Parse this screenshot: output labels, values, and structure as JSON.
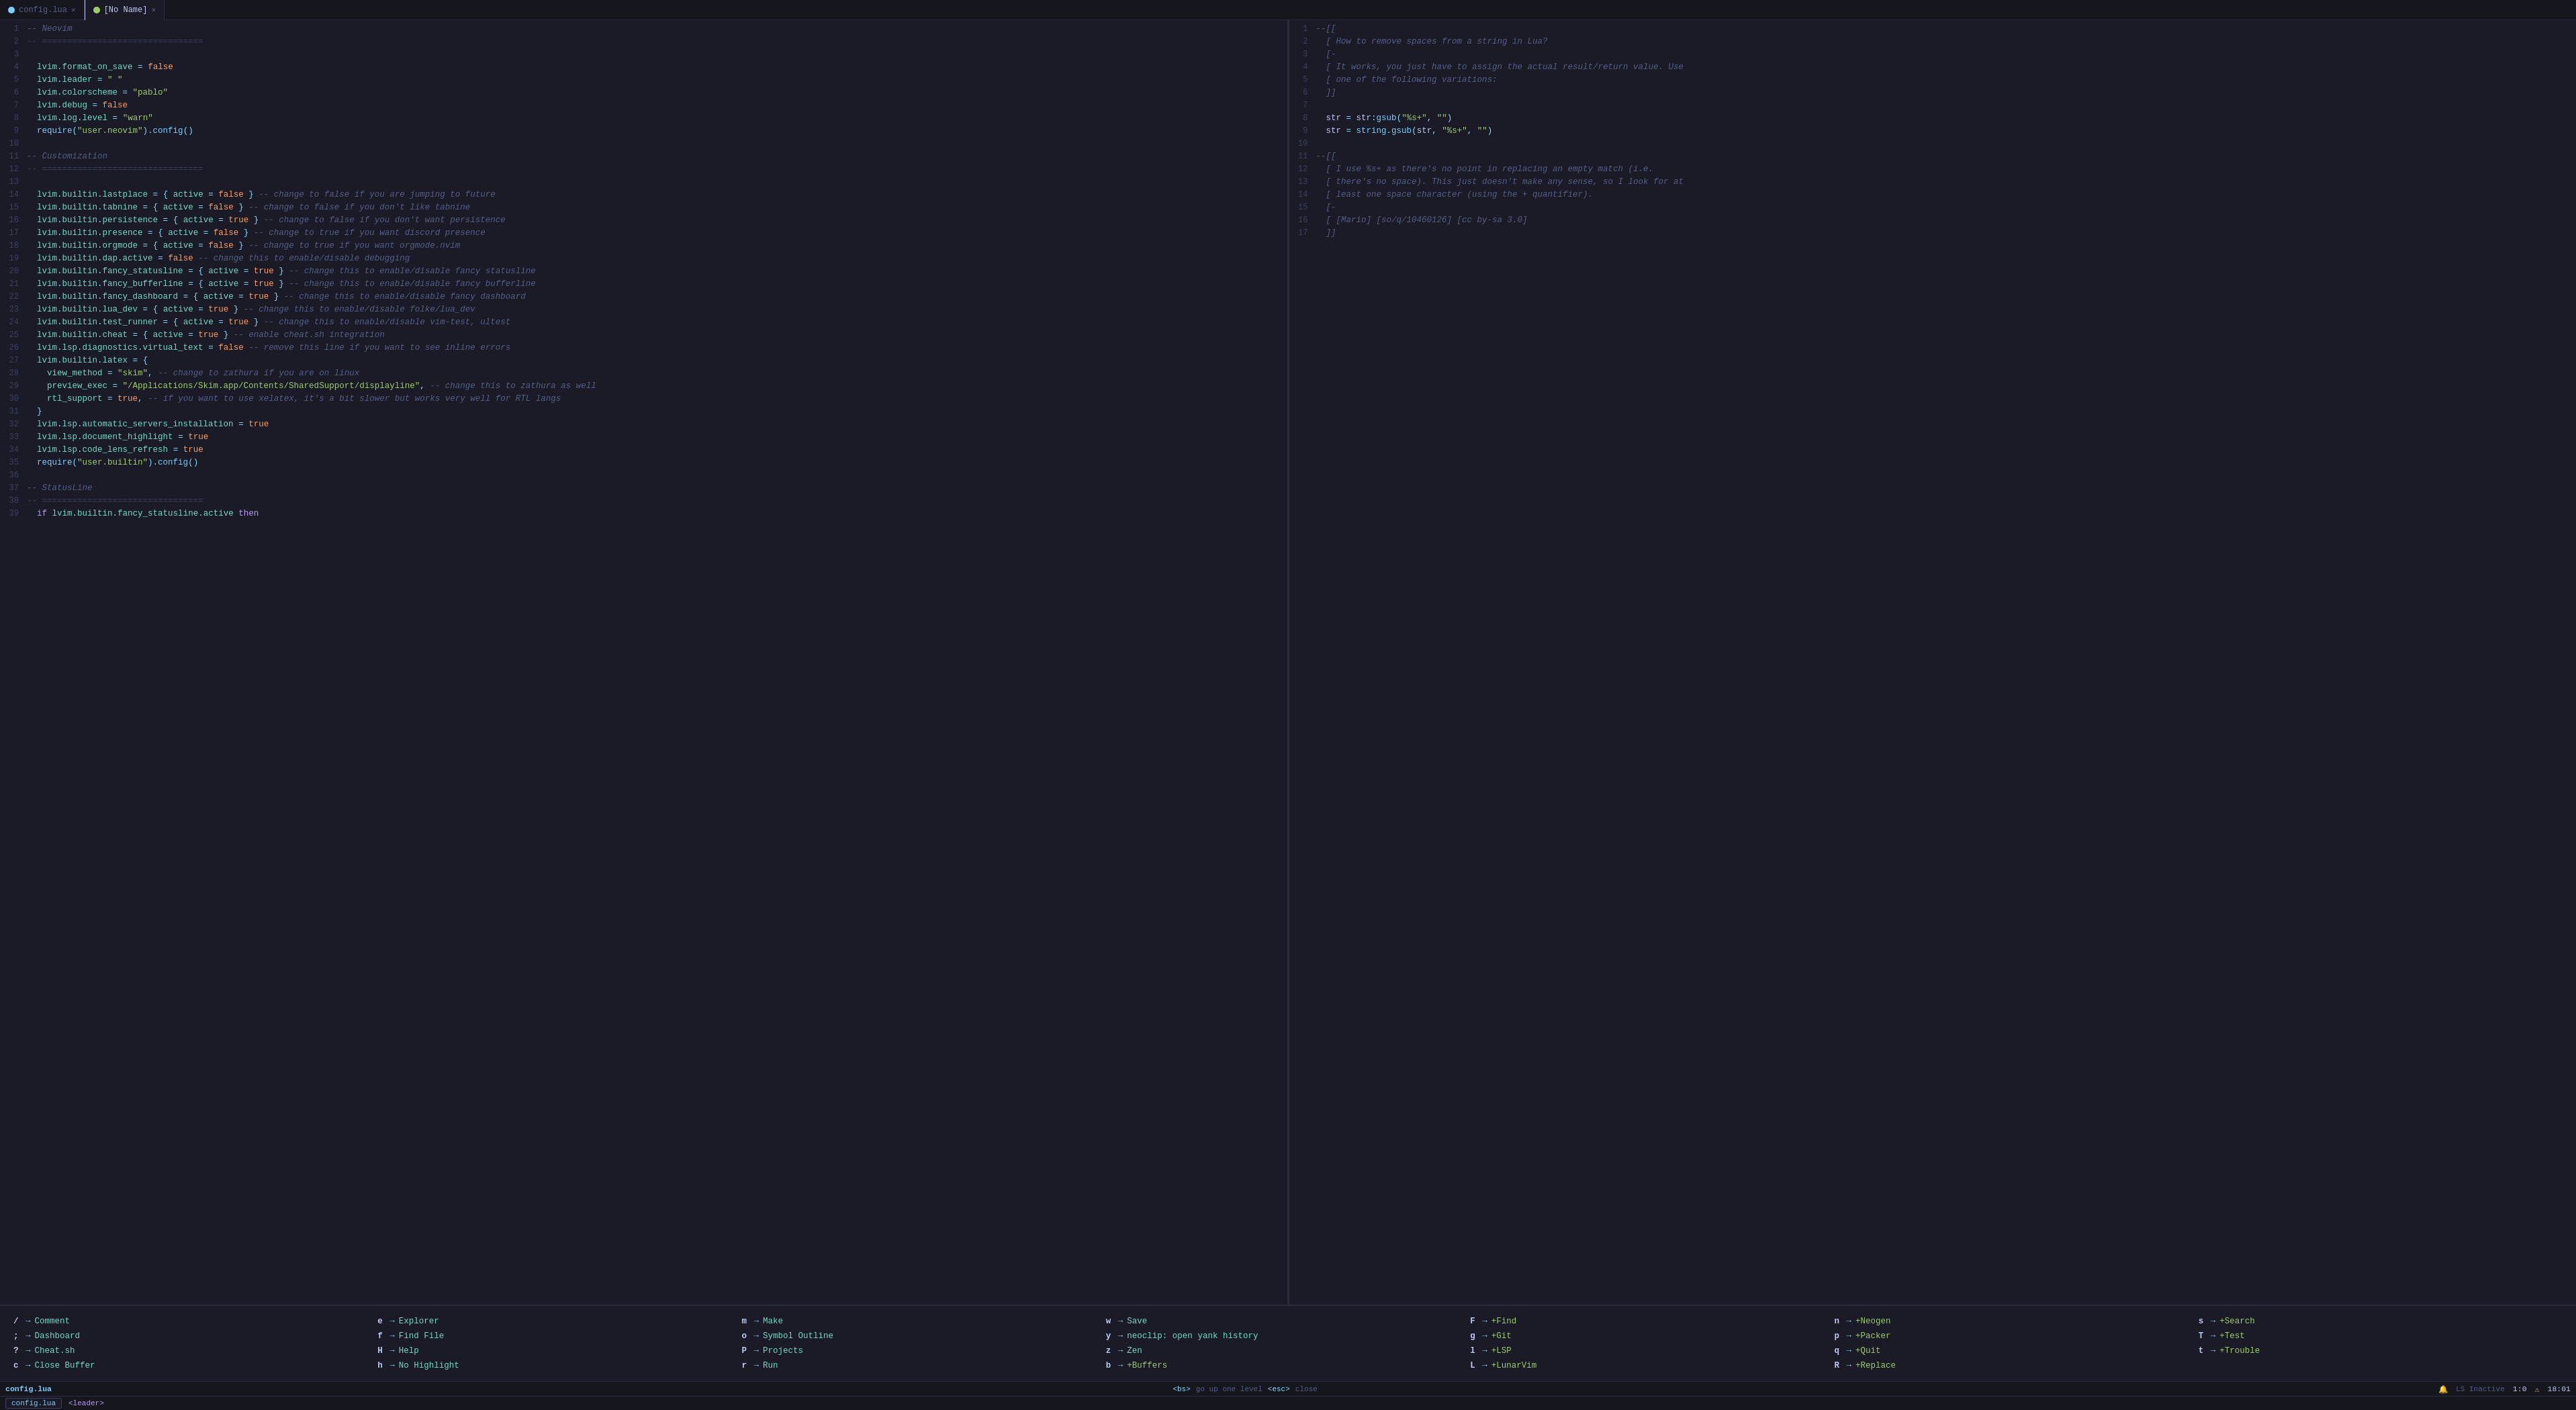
{
  "tabs": [
    {
      "id": "config-lua",
      "label": "config.lua",
      "icon": "lua",
      "active": false,
      "closable": true
    },
    {
      "id": "no-name",
      "label": "[No Name]",
      "icon": "noname",
      "active": true,
      "closable": true
    }
  ],
  "left_editor": {
    "filename": "config.lua",
    "lines": [
      {
        "n": 1,
        "text": "-- Neovim"
      },
      {
        "n": 2,
        "text": "-- ================================"
      },
      {
        "n": 3,
        "text": ""
      },
      {
        "n": 4,
        "text": "  lvim.format_on_save = false"
      },
      {
        "n": 5,
        "text": "  lvim.leader = \" \""
      },
      {
        "n": 6,
        "text": "  lvim.colorscheme = \"pablo\""
      },
      {
        "n": 7,
        "text": "  lvim.debug = false"
      },
      {
        "n": 8,
        "text": "  lvim.log.level = \"warn\""
      },
      {
        "n": 9,
        "text": "  require(\"user.neovim\").config()"
      },
      {
        "n": 10,
        "text": ""
      },
      {
        "n": 11,
        "text": "-- Customization"
      },
      {
        "n": 12,
        "text": "-- ================================"
      },
      {
        "n": 13,
        "text": ""
      },
      {
        "n": 14,
        "text": "  lvim.builtin.lastplace = { active = false } -- change to false if you are jumping to future"
      },
      {
        "n": 15,
        "text": "  lvim.builtin.tabnine = { active = false } -- change to false if you don't like tabnine"
      },
      {
        "n": 16,
        "text": "  lvim.builtin.persistence = { active = true } -- change to false if you don't want persistence"
      },
      {
        "n": 17,
        "text": "  lvim.builtin.presence = { active = false } -- change to true if you want discord presence"
      },
      {
        "n": 18,
        "text": "  lvim.builtin.orgmode = { active = false } -- change to true if you want orgmode.nvim"
      },
      {
        "n": 19,
        "text": "  lvim.builtin.dap.active = false -- change this to enable/disable debugging"
      },
      {
        "n": 20,
        "text": "  lvim.builtin.fancy_statusline = { active = true } -- change this to enable/disable fancy statusline"
      },
      {
        "n": 21,
        "text": "  lvim.builtin.fancy_bufferline = { active = true } -- change this to enable/disable fancy bufferline"
      },
      {
        "n": 22,
        "text": "  lvim.builtin.fancy_dashboard = { active = true } -- change this to enable/disable fancy dashboard"
      },
      {
        "n": 23,
        "text": "  lvim.builtin.lua_dev = { active = true } -- change this to enable/disable folke/lua_dev"
      },
      {
        "n": 24,
        "text": "  lvim.builtin.test_runner = { active = true } -- change this to enable/disable vim-test, ultest"
      },
      {
        "n": 25,
        "text": "  lvim.builtin.cheat = { active = true } -- enable cheat.sh integration"
      },
      {
        "n": 26,
        "text": "  lvim.lsp.diagnostics.virtual_text = false -- remove this line if you want to see inline errors"
      },
      {
        "n": 27,
        "text": "  lvim.builtin.latex = {"
      },
      {
        "n": 28,
        "text": "    view_method = \"skim\", -- change to zathura if you are on linux"
      },
      {
        "n": 29,
        "text": "    preview_exec = \"/Applications/Skim.app/Contents/SharedSupport/displayline\", -- change this to zathura as well"
      },
      {
        "n": 30,
        "text": "    rtl_support = true, -- if you want to use xelatex, it's a bit slower but works very well for RTL langs"
      },
      {
        "n": 31,
        "text": "  }"
      },
      {
        "n": 32,
        "text": "  lvim.lsp.automatic_servers_installation = true"
      },
      {
        "n": 33,
        "text": "  lvim.lsp.document_highlight = true"
      },
      {
        "n": 34,
        "text": "  lvim.lsp.code_lens_refresh = true"
      },
      {
        "n": 35,
        "text": "  require(\"user.builtin\").config()"
      },
      {
        "n": 36,
        "text": ""
      },
      {
        "n": 37,
        "text": "-- StatusLine"
      },
      {
        "n": 38,
        "text": "-- ================================"
      },
      {
        "n": 39,
        "text": "  if lvim.builtin.fancy_statusline.active then"
      }
    ]
  },
  "right_editor": {
    "filename": "[No Name]",
    "lines": [
      {
        "n": 1,
        "text": "--[["
      },
      {
        "n": 2,
        "text": "  [ How to remove spaces from a string in Lua?"
      },
      {
        "n": 3,
        "text": "  [-"
      },
      {
        "n": 4,
        "text": "  [ It works, you just have to assign the actual result/return value. Use"
      },
      {
        "n": 5,
        "text": "  [ one of the following variations:"
      },
      {
        "n": 6,
        "text": "  ]]"
      },
      {
        "n": 7,
        "text": ""
      },
      {
        "n": 8,
        "text": "  str = str:gsub(\"%s+\", \"\")"
      },
      {
        "n": 9,
        "text": "  str = string.gsub(str, \"%s+\", \"\")"
      },
      {
        "n": 10,
        "text": ""
      },
      {
        "n": 11,
        "text": "--[["
      },
      {
        "n": 12,
        "text": "  [ I use %s+ as there's no point in replacing an empty match (i.e."
      },
      {
        "n": 13,
        "text": "  [ there's no space). This just doesn't make any sense, so I look for at"
      },
      {
        "n": 14,
        "text": "  [ least one space character (using the + quantifier)."
      },
      {
        "n": 15,
        "text": "  [-"
      },
      {
        "n": 16,
        "text": "  [ [Mario] [so/q/10460126] [cc by-sa 3.0]"
      },
      {
        "n": 17,
        "text": "  ]]"
      }
    ]
  },
  "which_key": {
    "items": [
      {
        "key": "/",
        "arrow": "→",
        "desc": "Comment"
      },
      {
        "key": "e",
        "arrow": "→",
        "desc": "Explorer"
      },
      {
        "key": "m",
        "arrow": "→",
        "desc": "Make"
      },
      {
        "key": "w",
        "arrow": "→",
        "desc": "Save"
      },
      {
        "key": "F",
        "arrow": "→",
        "desc": "+Find"
      },
      {
        "key": "n",
        "arrow": "→",
        "desc": "+Neogen"
      },
      {
        "key": "s",
        "arrow": "→",
        "desc": "+Search"
      },
      {
        "key": ";",
        "arrow": "→",
        "desc": "Dashboard"
      },
      {
        "key": "f",
        "arrow": "→",
        "desc": "Find File"
      },
      {
        "key": "o",
        "arrow": "→",
        "desc": "Symbol Outline"
      },
      {
        "key": "y",
        "arrow": "→",
        "desc": "neoclip: open yank history"
      },
      {
        "key": "g",
        "arrow": "→",
        "desc": "+Git"
      },
      {
        "key": "p",
        "arrow": "→",
        "desc": "+Packer"
      },
      {
        "key": "T",
        "arrow": "→",
        "desc": "+Test"
      },
      {
        "key": "?",
        "arrow": "→",
        "desc": "Cheat.sh"
      },
      {
        "key": "H",
        "arrow": "→",
        "desc": "Help"
      },
      {
        "key": "P",
        "arrow": "→",
        "desc": "Projects"
      },
      {
        "key": "z",
        "arrow": "→",
        "desc": "Zen"
      },
      {
        "key": "l",
        "arrow": "→",
        "desc": "+LSP"
      },
      {
        "key": "q",
        "arrow": "→",
        "desc": "+Quit"
      },
      {
        "key": "t",
        "arrow": "→",
        "desc": "+Trouble"
      },
      {
        "key": "c",
        "arrow": "→",
        "desc": "Close Buffer"
      },
      {
        "key": "h",
        "arrow": "→",
        "desc": "No Highlight"
      },
      {
        "key": "r",
        "arrow": "→",
        "desc": "Run"
      },
      {
        "key": "b",
        "arrow": "→",
        "desc": "+Buffers"
      },
      {
        "key": "L",
        "arrow": "→",
        "desc": "+LunarVim"
      },
      {
        "key": "R",
        "arrow": "→",
        "desc": "+Replace"
      },
      {
        "key": "",
        "arrow": "",
        "desc": ""
      }
    ]
  },
  "status_bar": {
    "left": {
      "filename": "config.lua"
    },
    "center": {
      "bs_label": "<bs>",
      "bs_desc": "go up one level",
      "esc_label": "<esc>",
      "esc_desc": "close"
    },
    "right": {
      "bell_icon": "🔔",
      "ls_status": "LS Inactive",
      "position": "1:0",
      "warning_icon": "⚠",
      "time": "18:01"
    }
  },
  "mode_bar": {
    "label": "<leader>"
  }
}
